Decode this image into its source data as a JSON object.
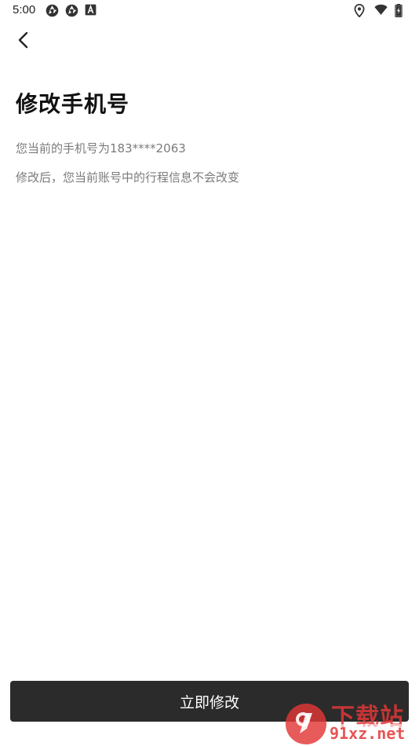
{
  "status_bar": {
    "time": "5:00",
    "left_icons": [
      "aperture-icon",
      "aperture-icon",
      "font-a-icon"
    ],
    "right_icons": [
      "location-icon",
      "wifi-icon",
      "battery-charging-icon"
    ]
  },
  "header": {
    "back_icon": "chevron-left-icon"
  },
  "main": {
    "title": "修改手机号",
    "phone_info": "您当前的手机号为183****2063",
    "notice": "修改后，您当前账号中的行程信息不会改变"
  },
  "footer": {
    "modify_button_label": "立即修改",
    "button_color": "#2b2b2b"
  },
  "watermark": {
    "top_text": "下载站",
    "bottom_text": "91xz.net",
    "logo_text": "9",
    "color": "#e23737"
  }
}
